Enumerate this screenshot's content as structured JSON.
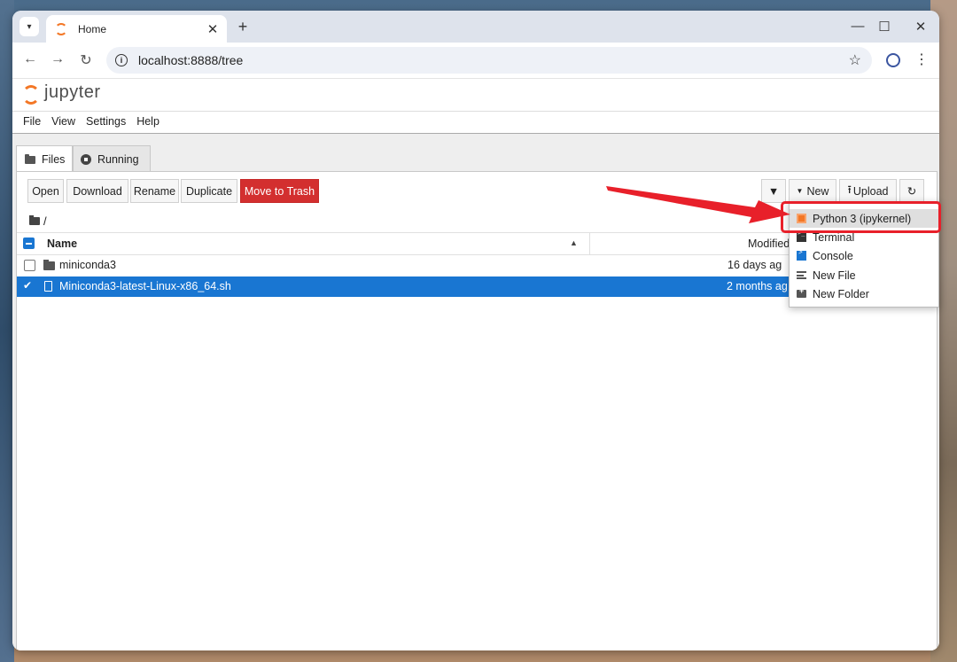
{
  "browser": {
    "tab_title": "Home",
    "url": "localhost:8888/tree",
    "new_tab_label": "+",
    "tab_close_glyph": "✕",
    "minimize_glyph": "—",
    "maximize_glyph": "☐",
    "close_glyph": "✕"
  },
  "app": {
    "logo_text": "jupyter",
    "menu": [
      "File",
      "View",
      "Settings",
      "Help"
    ]
  },
  "tabs": [
    {
      "label": "Files",
      "active": true
    },
    {
      "label": "Running",
      "active": false
    }
  ],
  "toolbar": {
    "open": "Open",
    "download": "Download",
    "rename": "Rename",
    "duplicate": "Duplicate",
    "trash": "Move to Trash",
    "new": "New",
    "upload": "Upload"
  },
  "breadcrumb": "/",
  "columns": {
    "name": "Name",
    "modified": "Modified"
  },
  "files": [
    {
      "name": "miniconda3",
      "modified": "16 days ag",
      "type": "folder",
      "selected": false
    },
    {
      "name": "Miniconda3-latest-Linux-x86_64.sh",
      "modified": "2 months ag",
      "type": "file",
      "selected": true
    }
  ],
  "new_menu": [
    {
      "label": "Python 3 (ipykernel)",
      "icon": "python-icon"
    },
    {
      "label": "Terminal",
      "icon": "terminal-icon"
    },
    {
      "label": "Console",
      "icon": "console-icon"
    },
    {
      "label": "New File",
      "icon": "file-icon"
    },
    {
      "label": "New Folder",
      "icon": "folder-plus-icon"
    }
  ],
  "colors": {
    "accent": "#1976d2",
    "danger": "#d32f2f",
    "annotation": "#e8202a",
    "jupyter_orange": "#f37726"
  }
}
